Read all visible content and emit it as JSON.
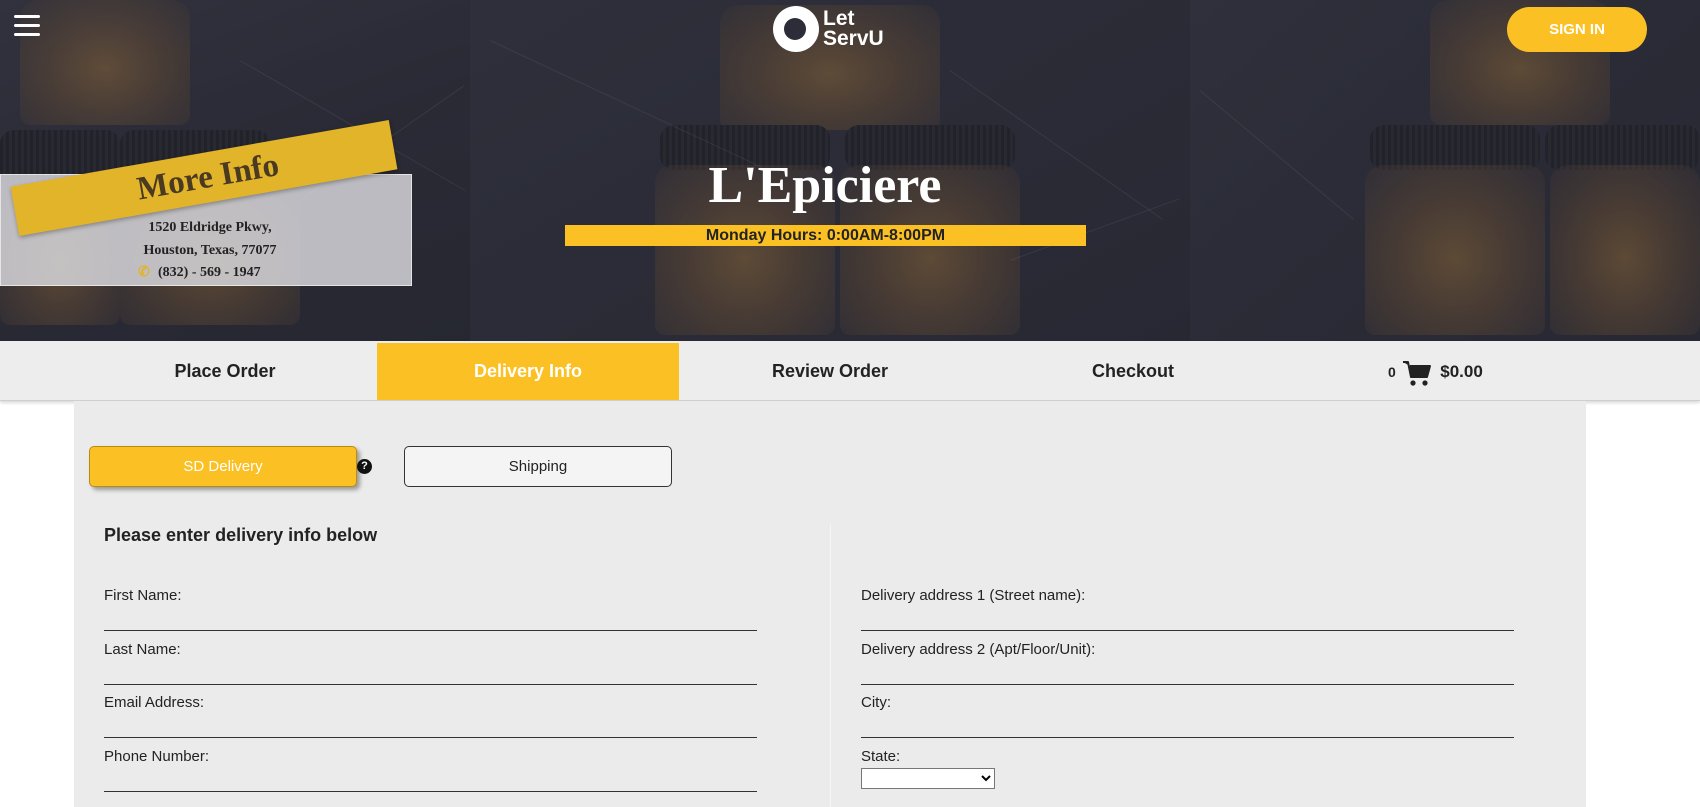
{
  "header": {
    "menu_icon": "hamburger-menu-icon",
    "logo_text_line1": "Let",
    "logo_text_line2": "ServU",
    "signin_label": "SIGN IN"
  },
  "store": {
    "name": "L'Epiciere",
    "hours": "Monday Hours:  0:00AM-8:00PM",
    "more_info_label": "More Info",
    "address_line1": "1520 Eldridge Pkwy,",
    "address_line2": "Houston, Texas, 77077",
    "phone": "(832) - 569 - 1947"
  },
  "nav": {
    "tabs": [
      {
        "label": "Place Order",
        "active": false
      },
      {
        "label": "Delivery Info",
        "active": true
      },
      {
        "label": "Review Order",
        "active": false
      },
      {
        "label": "Checkout",
        "active": false
      }
    ],
    "cart_count": "0",
    "cart_total": "$0.00"
  },
  "delivery": {
    "option_sd": "SD Delivery",
    "option_shipping": "Shipping",
    "help_icon": "?",
    "heading": "Please enter delivery info below",
    "left_fields": [
      {
        "label": "First Name:",
        "value": ""
      },
      {
        "label": "Last Name:",
        "value": ""
      },
      {
        "label": "Email Address:",
        "value": ""
      },
      {
        "label": "Phone Number:",
        "value": ""
      }
    ],
    "right_fields": [
      {
        "label": "Delivery address 1 (Street name):",
        "value": ""
      },
      {
        "label": "Delivery address 2 (Apt/Floor/Unit):",
        "value": ""
      },
      {
        "label": "City:",
        "value": ""
      },
      {
        "label": "State:",
        "value": ""
      }
    ]
  },
  "colors": {
    "accent": "#fbc024",
    "nav_bg": "#ededed",
    "form_bg": "#ebebeb"
  }
}
